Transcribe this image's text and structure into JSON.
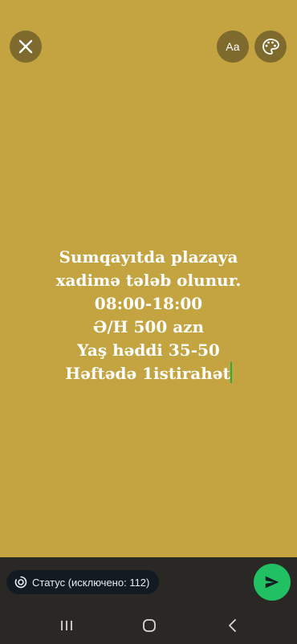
{
  "editor": {
    "background_color": "#c3a441",
    "text_lines": [
      "Sumqayıtda plazaya",
      "xadimə tələb olunur.",
      "08:00-18:00",
      "Ə/H 500 azn",
      "Yaş həddi 35-50",
      "Həftədə 1istirahət"
    ],
    "caret_color": "#1fb141"
  },
  "toolbar": {
    "close_icon": "close-icon",
    "font_label": "Aa",
    "palette_icon": "palette-icon"
  },
  "footer": {
    "privacy_label": "Статус (исключено: 112)",
    "privacy_icon": "privacy-ring-icon",
    "send_icon": "send-icon",
    "send_color": "#21c063"
  },
  "system_nav": {
    "recents_icon": "recents-icon",
    "home_icon": "home-icon",
    "back_icon": "back-icon"
  }
}
